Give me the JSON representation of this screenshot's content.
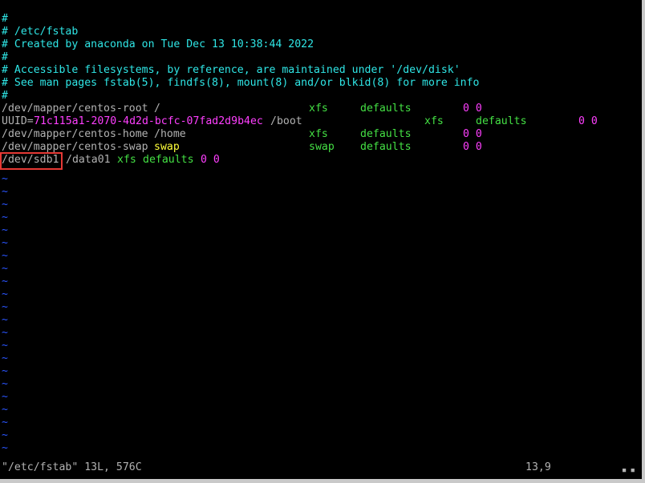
{
  "buffer": {
    "comments": [
      "#",
      "# /etc/fstab",
      "# Created by anaconda on Tue Dec 13 10:38:44 2022",
      "#",
      "# Accessible filesystems, by reference, are maintained under '/dev/disk'",
      "# See man pages fstab(5), findfs(8), mount(8) and/or blkid(8) for more info",
      "#"
    ],
    "entries": [
      {
        "device": "/dev/mapper/centos-root",
        "mount": "/",
        "fstype": "xfs",
        "options": "defaults",
        "dumppass": "0 0"
      },
      {
        "device_prefix": "UUID=",
        "device": "71c115a1-2070-4d2d-bcfc-07fad2d9b4ec",
        "mount": "/boot",
        "fstype": "xfs",
        "options": "defaults",
        "dumppass": "0 0"
      },
      {
        "device": "/dev/mapper/centos-home",
        "mount": "/home",
        "fstype": "xfs",
        "options": "defaults",
        "dumppass": "0 0"
      },
      {
        "device": "/dev/mapper/centos-swap",
        "mount": "swap",
        "fstype": "swap",
        "options": "defaults",
        "dumppass": "0 0"
      },
      {
        "device": "/dev/sdb1",
        "mount": "/data01",
        "fstype": "xfs",
        "options": "defaults",
        "dumppass": "0 0"
      }
    ],
    "tilde": "~"
  },
  "statusbar": {
    "file_info": "\"/etc/fstab\" 13L, 576C",
    "cursor_pos": "13,9"
  },
  "colors": {
    "background": "#000000",
    "comment": "#2fe6e6",
    "text": "#b2b2b2",
    "number": "#ff3fff",
    "keyword": "#44e044",
    "swap": "#ffff3a",
    "tilde": "#2a55ff",
    "highlight_box": "#e53935"
  }
}
